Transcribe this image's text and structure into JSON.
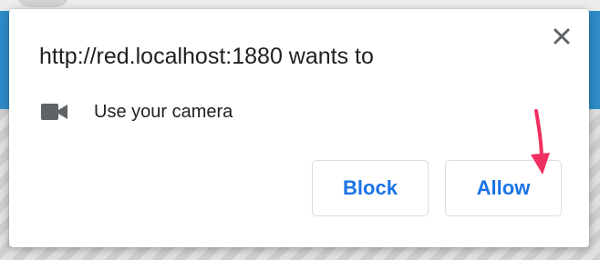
{
  "dialog": {
    "title": "http://red.localhost:1880 wants to",
    "permission": {
      "icon": "camera-icon",
      "label": "Use your camera"
    },
    "close_icon": "close-icon",
    "buttons": {
      "block_label": "Block",
      "allow_label": "Allow"
    }
  },
  "colors": {
    "button_text": "#1a73e8",
    "page_header": "#2e8cc8",
    "annotation_arrow": "#f0305f"
  }
}
